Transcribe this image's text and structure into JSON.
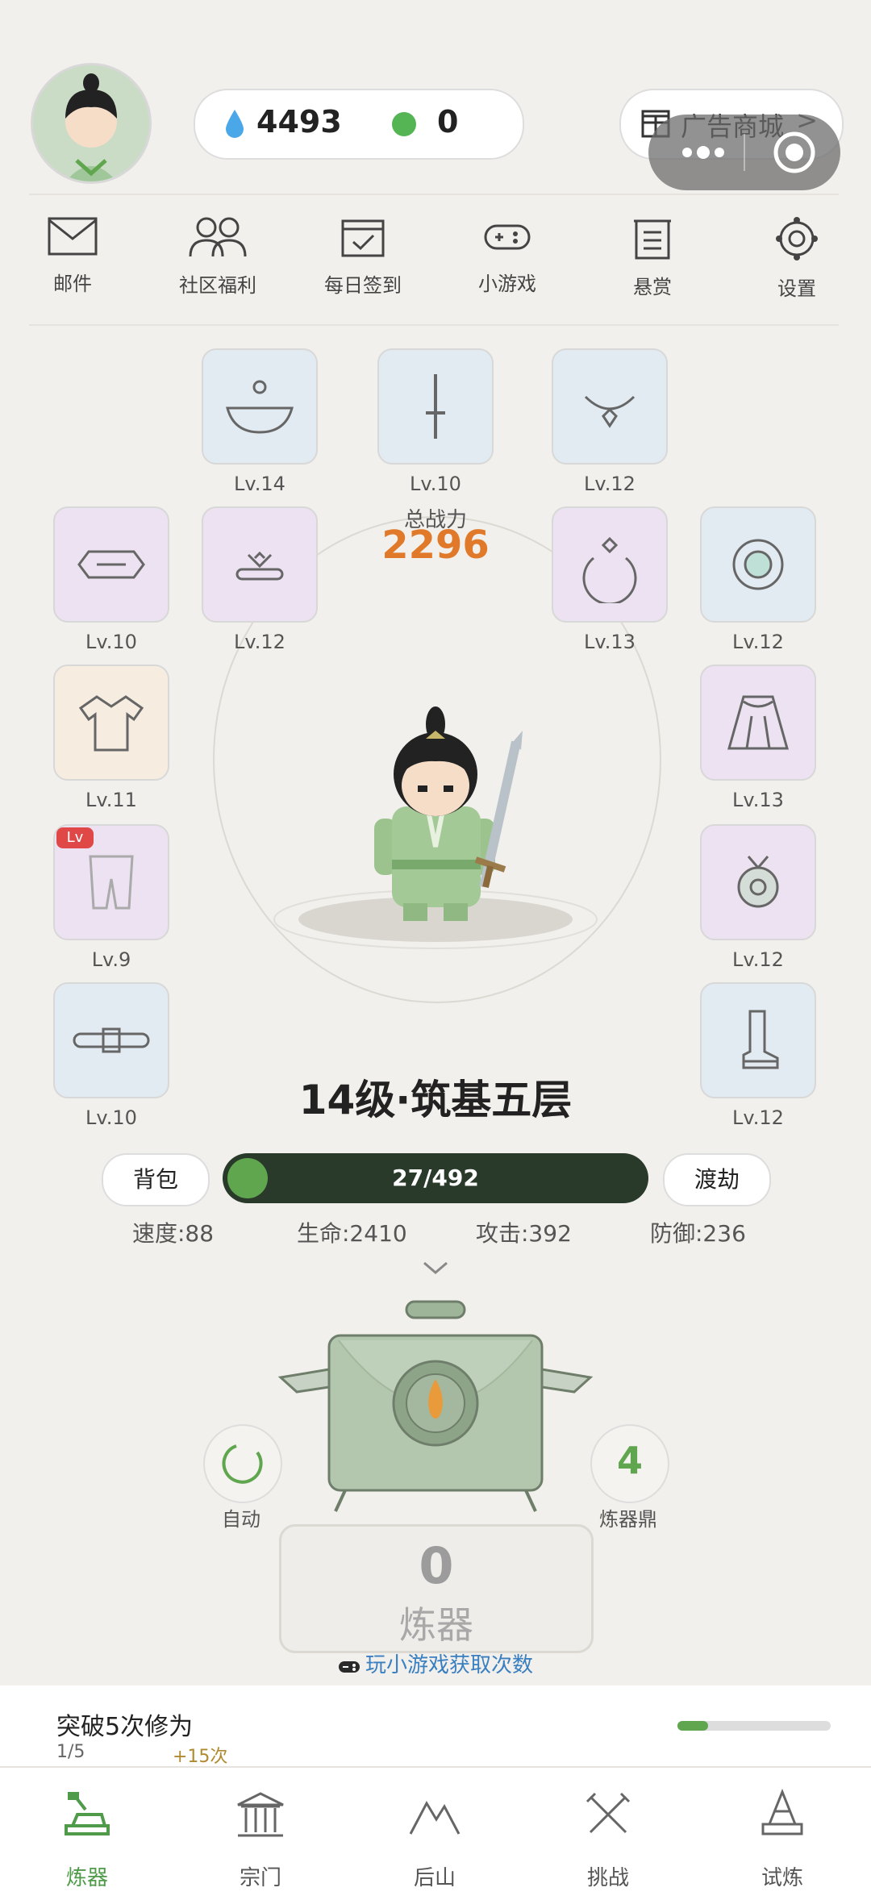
{
  "header": {
    "currency": [
      {
        "icon": "water-drop-icon",
        "value": "4493",
        "color": "#4aa8e8"
      },
      {
        "icon": "green-orb-icon",
        "value": "0",
        "color": "#55b555"
      }
    ],
    "shop_label": "广告商城",
    "shop_arrow": ">"
  },
  "nav": [
    {
      "icon": "mail-icon",
      "label": "邮件"
    },
    {
      "icon": "community-icon",
      "label": "社区福利"
    },
    {
      "icon": "calendar-check-icon",
      "label": "每日签到"
    },
    {
      "icon": "gamepad-icon",
      "label": "小游戏"
    },
    {
      "icon": "bounty-board-icon",
      "label": "悬赏"
    },
    {
      "icon": "gear-icon",
      "label": "设置"
    }
  ],
  "equipment": {
    "top": [
      {
        "icon": "hat-icon",
        "level": "Lv.14"
      },
      {
        "icon": "sword-icon",
        "level": "Lv.10"
      },
      {
        "icon": "necklace-icon",
        "level": "Lv.12"
      }
    ],
    "row2_left": [
      {
        "icon": "hexagon-plate-icon",
        "level": "Lv.10"
      },
      {
        "icon": "brooch-icon",
        "level": "Lv.12"
      }
    ],
    "row2_right": [
      {
        "icon": "ring-icon",
        "level": "Lv.13"
      },
      {
        "icon": "jade-disc-icon",
        "level": "Lv.12"
      }
    ],
    "left": [
      {
        "icon": "robe-icon",
        "level": "Lv.11"
      },
      {
        "icon": "pants-icon",
        "level": "Lv.9",
        "badge": "Lv"
      },
      {
        "icon": "belt-icon",
        "level": "Lv.10"
      }
    ],
    "right": [
      {
        "icon": "skirt-icon",
        "level": "Lv.13"
      },
      {
        "icon": "pendant-icon",
        "level": "Lv.12"
      },
      {
        "icon": "boot-icon",
        "level": "Lv.12"
      }
    ]
  },
  "power": {
    "label": "总战力",
    "value": "2296"
  },
  "realm": "14级·筑基五层",
  "actions": {
    "bag": "背包",
    "tribulation": "渡劫"
  },
  "exp": {
    "text": "27/492",
    "fraction": 0.055
  },
  "stats": [
    {
      "label": "速度:88"
    },
    {
      "label": "生命:2410"
    },
    {
      "label": "攻击:392"
    },
    {
      "label": "防御:236"
    }
  ],
  "forge": {
    "auto_label": "自动",
    "cauldron_count": "4",
    "cauldron_label": "炼器鼎",
    "count": "0",
    "label": "炼器",
    "hint": "玩小游戏获取次数"
  },
  "task": {
    "title": "突破5次修为",
    "progress": "1/5",
    "reward": "+15次",
    "fraction": 0.2
  },
  "tabs": [
    {
      "icon": "forge-icon",
      "label": "炼器",
      "active": true
    },
    {
      "icon": "sect-icon",
      "label": "宗门",
      "active": false
    },
    {
      "icon": "mountain-icon",
      "label": "后山",
      "active": false
    },
    {
      "icon": "crossed-swords-icon",
      "label": "挑战",
      "active": false
    },
    {
      "icon": "tower-icon",
      "label": "试炼",
      "active": false
    }
  ],
  "colors": {
    "accent": "#4f9b4a",
    "power": "#e07a2a",
    "hint": "#3a7fc0"
  }
}
